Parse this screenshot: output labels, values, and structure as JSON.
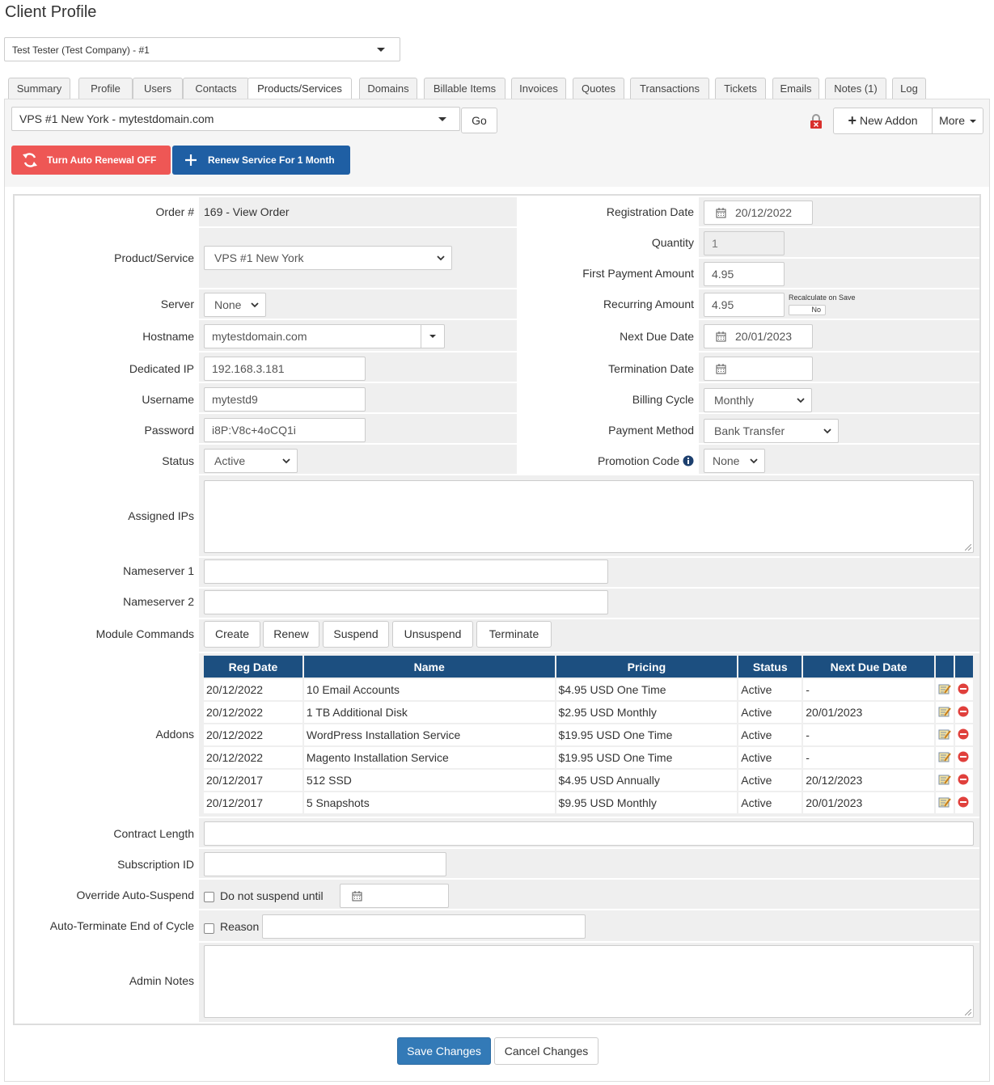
{
  "page_title": "Client Profile",
  "client_select": "Test Tester (Test Company) - #1",
  "tabs": [
    {
      "label": "Summary"
    },
    {
      "label": "Profile"
    },
    {
      "label": "Users"
    },
    {
      "label": "Contacts"
    },
    {
      "label": "Products/Services"
    },
    {
      "label": "Domains"
    },
    {
      "label": "Billable Items"
    },
    {
      "label": "Invoices"
    },
    {
      "label": "Quotes"
    },
    {
      "label": "Transactions"
    },
    {
      "label": "Tickets"
    },
    {
      "label": "Emails"
    },
    {
      "label": "Notes (1)"
    },
    {
      "label": "Log"
    }
  ],
  "active_tab": "Products/Services",
  "service_select": "VPS #1 New York - mytestdomain.com",
  "toolbar": {
    "go_label": "Go",
    "new_addon_label": "New Addon",
    "more_label": "More",
    "auto_renewal_label": "Turn Auto Renewal OFF",
    "renew_label": "Renew Service For 1 Month"
  },
  "form": {
    "order_label": "Order #",
    "order_value": "169 - View Order",
    "product_label": "Product/Service",
    "product_value": "VPS #1 New York",
    "server_label": "Server",
    "server_value": "None",
    "hostname_label": "Hostname",
    "hostname_value": "mytestdomain.com",
    "dedicated_ip_label": "Dedicated IP",
    "dedicated_ip_value": "192.168.3.181",
    "username_label": "Username",
    "username_value": "mytestd9",
    "password_label": "Password",
    "password_value": "i8P:V8c+4oCQ1i",
    "status_label": "Status",
    "status_value": "Active",
    "reg_date_label": "Registration Date",
    "reg_date_value": "20/12/2022",
    "quantity_label": "Quantity",
    "quantity_value": "1",
    "first_payment_label": "First Payment Amount",
    "first_payment_value": "4.95",
    "recurring_label": "Recurring Amount",
    "recurring_value": "4.95",
    "recalculate_label": "Recalculate on Save",
    "recalculate_value": "No",
    "next_due_label": "Next Due Date",
    "next_due_value": "20/01/2023",
    "termination_label": "Termination Date",
    "termination_value": "",
    "billing_cycle_label": "Billing Cycle",
    "billing_cycle_value": "Monthly",
    "payment_method_label": "Payment Method",
    "payment_method_value": "Bank Transfer",
    "promo_label": "Promotion Code",
    "promo_value": "None",
    "assigned_ips_label": "Assigned IPs",
    "ns1_label": "Nameserver 1",
    "ns2_label": "Nameserver 2",
    "module_commands_label": "Module Commands",
    "module_commands": [
      "Create",
      "Renew",
      "Suspend",
      "Unsuspend",
      "Terminate"
    ],
    "addons_label": "Addons",
    "contract_length_label": "Contract Length",
    "subscription_id_label": "Subscription ID",
    "override_label": "Override Auto-Suspend",
    "override_checkbox_label": "Do not suspend until",
    "auto_terminate_label": "Auto-Terminate End of Cycle",
    "reason_label": "Reason",
    "admin_notes_label": "Admin Notes"
  },
  "addons": {
    "headers": [
      "Reg Date",
      "Name",
      "Pricing",
      "Status",
      "Next Due Date"
    ],
    "rows": [
      {
        "reg": "20/12/2022",
        "name": "10 Email Accounts",
        "pricing": "$4.95 USD One Time",
        "status": "Active",
        "due": "-"
      },
      {
        "reg": "20/12/2022",
        "name": "1 TB Additional Disk",
        "pricing": "$2.95 USD Monthly",
        "status": "Active",
        "due": "20/01/2023"
      },
      {
        "reg": "20/12/2022",
        "name": "WordPress Installation Service",
        "pricing": "$19.95 USD One Time",
        "status": "Active",
        "due": "-"
      },
      {
        "reg": "20/12/2022",
        "name": "Magento Installation Service",
        "pricing": "$19.95 USD One Time",
        "status": "Active",
        "due": "-"
      },
      {
        "reg": "20/12/2017",
        "name": "512 SSD",
        "pricing": "$4.95 USD Annually",
        "status": "Active",
        "due": "20/12/2023"
      },
      {
        "reg": "20/12/2017",
        "name": "5 Snapshots",
        "pricing": "$9.95 USD Monthly",
        "status": "Active",
        "due": "20/01/2023"
      }
    ]
  },
  "actions": {
    "save_label": "Save Changes",
    "cancel_label": "Cancel Changes"
  },
  "colors": {
    "accent_blue": "#1f5fa4",
    "danger_red": "#ee5755",
    "table_header": "#1c4f80"
  }
}
